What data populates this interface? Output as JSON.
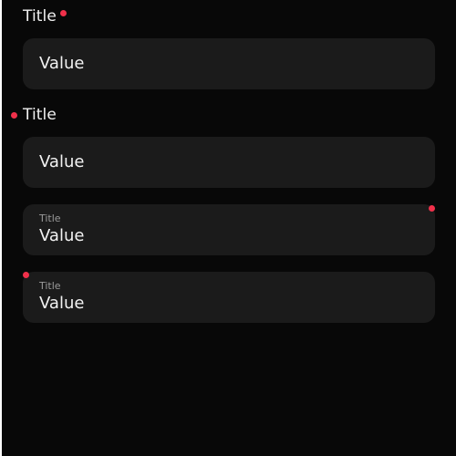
{
  "colors": {
    "background": "#080808",
    "field_background": "#1b1b1b",
    "required_indicator": "#f0304a",
    "text": "#f2f2f2",
    "secondary_text": "#9a9a9a"
  },
  "fields": [
    {
      "title": "Title",
      "value": "Value",
      "label_style": "outside",
      "indicator_position": "after-title"
    },
    {
      "title": "Title",
      "value": "Value",
      "label_style": "outside",
      "indicator_position": "before-title"
    },
    {
      "title": "Title",
      "value": "Value",
      "label_style": "inside",
      "indicator_position": "top-right"
    },
    {
      "title": "Title",
      "value": "Value",
      "label_style": "inside",
      "indicator_position": "top-left"
    }
  ]
}
